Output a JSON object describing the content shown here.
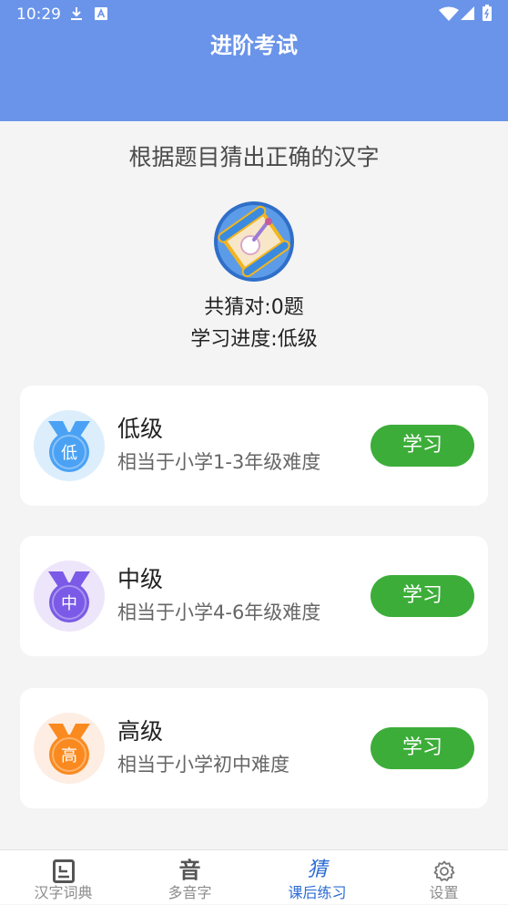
{
  "status_bar": {
    "time": "10:29",
    "left_icons": [
      "download-icon",
      "a-icon"
    ],
    "right_icons": [
      "wifi-icon",
      "signal-icon",
      "battery-icon"
    ]
  },
  "header": {
    "title": "进阶考试"
  },
  "intro": {
    "instruction": "根据题目猜出正确的汉字",
    "score_text": "共猜对:0题",
    "progress_text": "学习进度:低级"
  },
  "levels": [
    {
      "badge_char": "低",
      "title": "低级",
      "description": "相当于小学1-3年级难度",
      "button_label": "学习",
      "medal_color": "#4BA2F4",
      "medal_bg": "#DCEEFC"
    },
    {
      "badge_char": "中",
      "title": "中级",
      "description": "相当于小学4-6年级难度",
      "button_label": "学习",
      "medal_color": "#7A5AE6",
      "medal_bg": "#EDE5FA"
    },
    {
      "badge_char": "高",
      "title": "高级",
      "description": "相当于小学初中难度",
      "button_label": "学习",
      "medal_color": "#FA8A1F",
      "medal_bg": "#FDEDE2"
    }
  ],
  "bottom_nav": {
    "active_index": 2,
    "items": [
      {
        "label": "汉字词典",
        "icon": "dictionary-icon"
      },
      {
        "label": "多音字",
        "icon": "polyphone-icon",
        "glyph": "音"
      },
      {
        "label": "课后练习",
        "icon": "practice-icon",
        "glyph": "猜"
      },
      {
        "label": "设置",
        "icon": "gear-icon"
      }
    ]
  },
  "colors": {
    "header": "#6A94E9",
    "background": "#F4F4F4",
    "button": "#3DAD3A",
    "active_tab": "#2B6CD4"
  }
}
